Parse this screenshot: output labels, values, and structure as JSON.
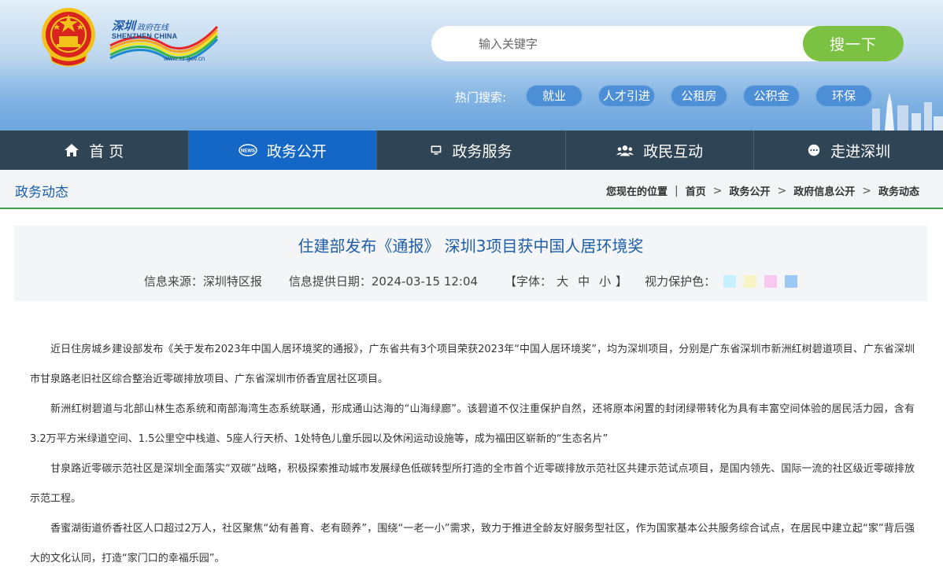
{
  "header": {
    "logo": {
      "cn": "深圳",
      "cn_small": "政府在线",
      "en": "SHENZHEN CHINA",
      "url": "www.sz.gov.cn"
    },
    "search": {
      "placeholder": "输入关键字",
      "button_label": "搜一下"
    },
    "hot_search": {
      "label": "热门搜索:",
      "tags": [
        "就业",
        "人才引进",
        "公租房",
        "公积金",
        "环保"
      ]
    }
  },
  "nav": {
    "items": [
      {
        "label": "首 页",
        "icon": "home-icon"
      },
      {
        "label": "政务公开",
        "icon": "news-icon"
      },
      {
        "label": "政务服务",
        "icon": "monitor-icon"
      },
      {
        "label": "政民互动",
        "icon": "users-icon"
      },
      {
        "label": "走进深圳",
        "icon": "chat-icon"
      }
    ],
    "active_index": 1
  },
  "breadcrumb": {
    "section_title": "政务动态",
    "label": "您现在的位置",
    "items": [
      "首页",
      "政务公开",
      "政府信息公开",
      "政务动态"
    ],
    "separator": ">"
  },
  "article": {
    "title": "住建部发布《通报》 深圳3项目获中国人居环境奖",
    "source": "信息来源：深圳特区报",
    "date": "信息提供日期：2024-03-15 12:04",
    "font_size_label": "【字体：",
    "font_sizes": [
      "大",
      "中",
      "小"
    ],
    "font_size_end": "】",
    "eye_care_label": "视力保护色：",
    "eye_care_colors": [
      "#c6efff",
      "#f8f3c4",
      "#f8c8f0",
      "#9cc8f4"
    ],
    "paragraphs": [
      "近日住房城乡建设部发布《关于发布2023年中国人居环境奖的通报》，广东省共有3个项目荣获2023年“中国人居环境奖”，均为深圳项目，分别是广东省深圳市新洲红树碧道项目、广东省深圳市甘泉路老旧社区综合整治近零碳排放项目、广东省深圳市侨香宜居社区项目。",
      "新洲红树碧道与北部山林生态系统和南部海湾生态系统联通，形成通山达海的“山海绿廊”。该碧道不仅注重保护自然，还将原本闲置的封闭绿带转化为具有丰富空间体验的居民活力园，含有3.2万平方米绿道空间、1.5公里空中栈道、5座人行天桥、1处特色儿童乐园以及休闲运动设施等，成为福田区崭新的“生态名片”",
      "甘泉路近零碳示范社区是深圳全面落实“双碳”战略，积极探索推动城市发展绿色低碳转型所打造的全市首个近零碳排放示范社区共建示范试点项目，是国内领先、国际一流的社区级近零碳排放示范工程。",
      "香蜜湖街道侨香社区人口超过2万人，社区聚焦“幼有善育、老有颐养”，围绕“一老一小”需求，致力于推进全龄友好服务型社区，作为国家基本公共服务综合试点，在居民中建立起“家”背后强大的文化认同，打造“家门口的幸福乐园”。"
    ]
  }
}
